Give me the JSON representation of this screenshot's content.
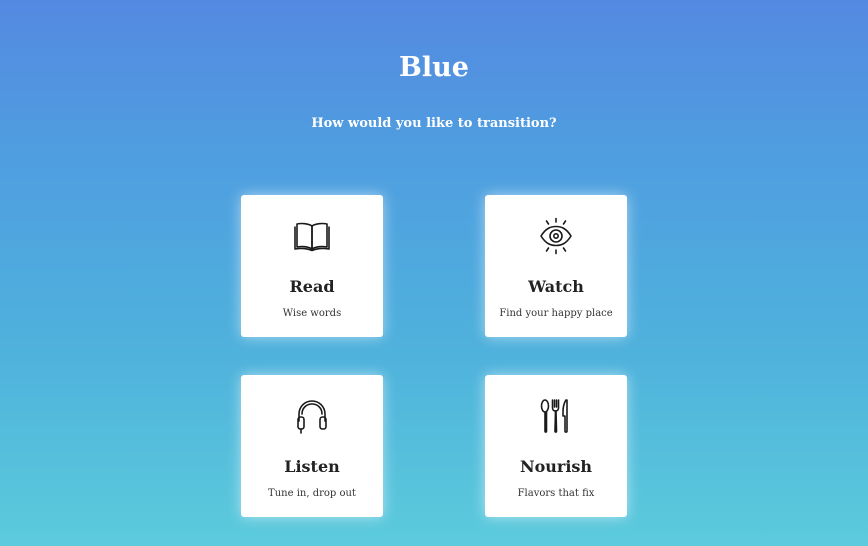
{
  "header": {
    "title": "Blue",
    "subtitle": "How would you like to transition?"
  },
  "cards": [
    {
      "title": "Read",
      "description": "Wise words",
      "icon": "book-icon"
    },
    {
      "title": "Watch",
      "description": "Find your happy place",
      "icon": "eye-icon"
    },
    {
      "title": "Listen",
      "description": "Tune in, drop out",
      "icon": "headphones-icon"
    },
    {
      "title": "Nourish",
      "description": "Flavors that fix",
      "icon": "utensils-icon"
    }
  ],
  "colors": {
    "gradient_top": "#5489e1",
    "gradient_bottom": "#5ccbdc",
    "card_background": "#ffffff",
    "text_dark": "#222222"
  }
}
